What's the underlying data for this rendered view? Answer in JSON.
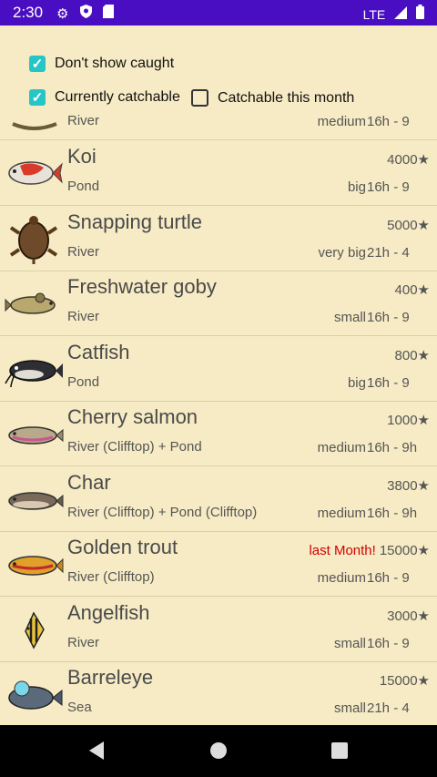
{
  "status": {
    "time": "2:30",
    "network": "LTE",
    "icons": [
      "gear-icon",
      "shield-icon",
      "sd-card-icon",
      "signal-icon",
      "battery-icon"
    ]
  },
  "filters": {
    "dont_show_caught": {
      "label": "Don't show caught",
      "checked": true
    },
    "currently_catchable": {
      "label": "Currently catchable",
      "checked": true
    },
    "catchable_this_month": {
      "label": "Catchable this month",
      "checked": false
    }
  },
  "fish": [
    {
      "name": "",
      "location": "River",
      "size": "medium",
      "time": "16h - 9",
      "price": "",
      "icon": "partial-fish-icon"
    },
    {
      "name": "Koi",
      "location": "Pond",
      "size": "big",
      "time": "16h - 9",
      "price": "4000★",
      "icon": "koi-icon"
    },
    {
      "name": "Snapping turtle",
      "location": "River",
      "size": "very big",
      "time": "21h - 4",
      "price": "5000★",
      "icon": "snapping-turtle-icon"
    },
    {
      "name": "Freshwater goby",
      "location": "River",
      "size": "small",
      "time": "16h - 9",
      "price": "400★",
      "icon": "freshwater-goby-icon"
    },
    {
      "name": "Catfish",
      "location": "Pond",
      "size": "big",
      "time": "16h - 9",
      "price": "800★",
      "icon": "catfish-icon"
    },
    {
      "name": "Cherry salmon",
      "location": "River (Clifftop) + Pond",
      "size": "medium",
      "time": "16h - 9h",
      "price": "1000★",
      "icon": "cherry-salmon-icon"
    },
    {
      "name": "Char",
      "location": "River (Clifftop) + Pond (Clifftop)",
      "size": "medium",
      "time": "16h - 9h",
      "price": "3800★",
      "icon": "char-icon"
    },
    {
      "name": "Golden trout",
      "location": "River (Clifftop)",
      "size": "medium",
      "time": "16h - 9",
      "price": "15000★",
      "warning": "last Month!",
      "icon": "golden-trout-icon"
    },
    {
      "name": "Angelfish",
      "location": "River",
      "size": "small",
      "time": "16h - 9",
      "price": "3000★",
      "icon": "angelfish-icon"
    },
    {
      "name": "Barreleye",
      "location": "Sea",
      "size": "small",
      "time": "21h - 4",
      "price": "15000★",
      "icon": "barreleye-icon"
    }
  ],
  "nav": {
    "icons": [
      "back-icon",
      "home-icon",
      "recents-icon"
    ]
  }
}
